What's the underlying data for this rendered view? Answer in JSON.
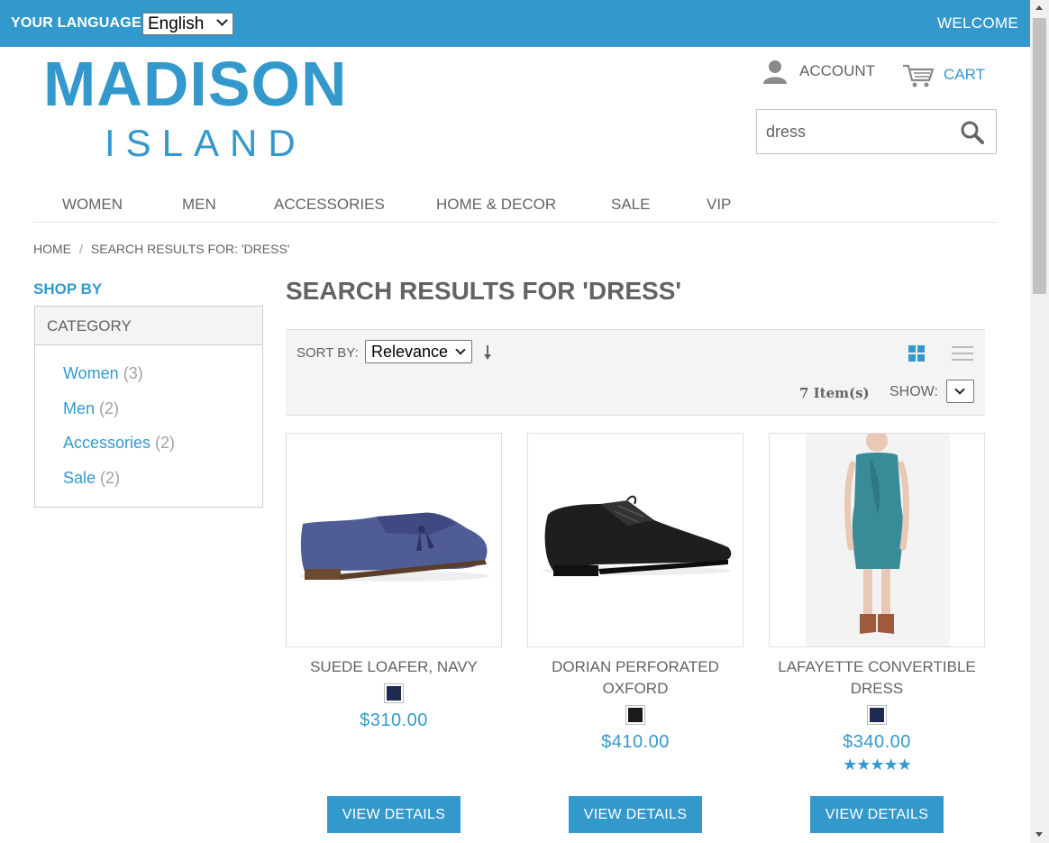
{
  "topbar": {
    "language_label": "YOUR LANGUAGE:",
    "language_value": "English",
    "welcome": "WELCOME"
  },
  "header": {
    "logo_line1": "MADISON",
    "logo_line2": "ISLAND",
    "account_label": "ACCOUNT",
    "cart_label": "CART",
    "search_value": "dress"
  },
  "nav": {
    "items": [
      {
        "label": "WOMEN"
      },
      {
        "label": "MEN"
      },
      {
        "label": "ACCESSORIES"
      },
      {
        "label": "HOME & DECOR"
      },
      {
        "label": "SALE"
      },
      {
        "label": "VIP"
      }
    ]
  },
  "breadcrumb": {
    "home": "HOME",
    "separator": "/",
    "current": "SEARCH RESULTS FOR: 'DRESS'"
  },
  "sidebar": {
    "shop_by": "SHOP BY",
    "category_heading": "CATEGORY",
    "categories": [
      {
        "name": "Women",
        "count": "(3)"
      },
      {
        "name": "Men",
        "count": "(2)"
      },
      {
        "name": "Accessories",
        "count": "(2)"
      },
      {
        "name": "Sale",
        "count": "(2)"
      }
    ]
  },
  "main": {
    "title": "SEARCH RESULTS FOR 'DRESS'",
    "toolbar": {
      "sort_label": "SORT BY:",
      "sort_value": "Relevance",
      "items_count": "7 Item(s)",
      "show_label": "SHOW:",
      "show_value": ""
    },
    "products": [
      {
        "name": "SUEDE LOAFER, NAVY",
        "price": "$310.00",
        "swatch_color": "#1f2a52",
        "button": "VIEW DETAILS",
        "rating": ""
      },
      {
        "name": "DORIAN PERFORATED OXFORD",
        "price": "$410.00",
        "swatch_color": "#1a1a1a",
        "button": "VIEW DETAILS",
        "rating": ""
      },
      {
        "name": "LAFAYETTE CONVERTIBLE DRESS",
        "price": "$340.00",
        "swatch_color": "#1f2a52",
        "button": "VIEW DETAILS",
        "rating": "★★★★★"
      }
    ]
  },
  "colors": {
    "brand": "#3399cc",
    "text": "#636363"
  }
}
